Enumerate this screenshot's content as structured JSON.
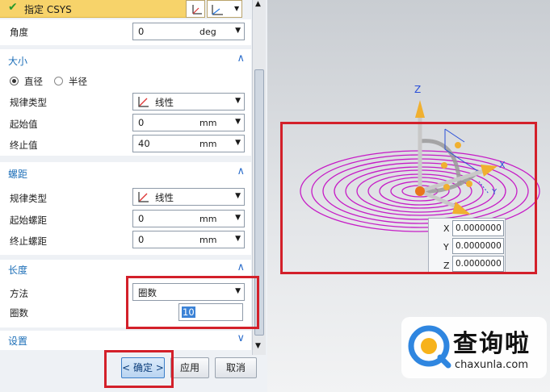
{
  "csys": {
    "label": "指定 CSYS"
  },
  "angle": {
    "label": "角度",
    "value": "0",
    "unit": "deg"
  },
  "size": {
    "title": "大小",
    "radio_diameter": "直径",
    "radio_radius": "半径",
    "law_type_label": "规律类型",
    "law_type_value": "线性",
    "start_label": "起始值",
    "start_value": "0",
    "start_unit": "mm",
    "end_label": "终止值",
    "end_value": "40",
    "end_unit": "mm"
  },
  "pitch": {
    "title": "螺距",
    "law_type_label": "规律类型",
    "law_type_value": "线性",
    "start_label": "起始螺距",
    "start_value": "0",
    "start_unit": "mm",
    "end_label": "终止螺距",
    "end_value": "0",
    "end_unit": "mm"
  },
  "length": {
    "title": "长度",
    "method_label": "方法",
    "method_value": "圈数",
    "turns_label": "圈数",
    "turns_value": "10"
  },
  "settings": {
    "title": "设置"
  },
  "buttons": {
    "ok": "< 确定 >",
    "apply": "应用",
    "cancel": "取消"
  },
  "viewport": {
    "axis_z": "Z",
    "axis_x": "X",
    "axis_y": "Y",
    "coord_x_label": "X",
    "coord_x_value": "0.0000000",
    "coord_y_label": "Y",
    "coord_y_value": "0.0000000",
    "coord_z_label": "Z",
    "coord_z_value": "0.0000000"
  },
  "watermark": {
    "brand": "查询啦",
    "domain": "chaxunla.com"
  },
  "colors": {
    "accent": "#1d6fb8",
    "spiral": "#c61cc6",
    "highlight": "#d3202a",
    "csys_bar": "#f7d36a",
    "check": "#2a9a2a"
  },
  "icons": [
    "check-icon",
    "csys-dialog-icon",
    "csys-axes-icon",
    "chevron-up-icon",
    "chevron-down-icon",
    "linear-law-icon",
    "scroll-up-icon",
    "scroll-down-icon",
    "search-logo-icon"
  ]
}
